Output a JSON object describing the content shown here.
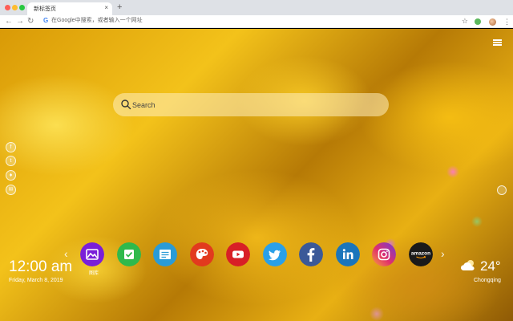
{
  "browser": {
    "tab_title": "新标签页",
    "tab_close": "×",
    "new_tab": "+",
    "omnibox_placeholder": "在Google中搜索，或者输入一个网址",
    "bookmark_icon": "star-icon",
    "menu_icon": "⋮"
  },
  "search": {
    "placeholder": "Search"
  },
  "apps": [
    {
      "name": "gallery",
      "label": "图库",
      "color": "#7a1fd8"
    },
    {
      "name": "checklist",
      "label": "",
      "color": "#2fb94c"
    },
    {
      "name": "notes",
      "label": "",
      "color": "#2a9bd6"
    },
    {
      "name": "paint",
      "label": "",
      "color": "#e23a1e"
    },
    {
      "name": "youtube",
      "label": "",
      "color": "#d81f26"
    },
    {
      "name": "twitter",
      "label": "",
      "color": "#2aa0e8"
    },
    {
      "name": "facebook",
      "label": "",
      "color": "#3b5998"
    },
    {
      "name": "linkedin",
      "label": "",
      "color": "#1a75bb"
    },
    {
      "name": "instagram",
      "label": "",
      "color": "#c13584"
    },
    {
      "name": "amazon",
      "label": "amazon",
      "color": "#1a1a1a"
    }
  ],
  "clock": {
    "time": "12:00 am",
    "date": "Friday, March 8, 2019"
  },
  "weather": {
    "temperature": "24°",
    "city": "Chongqing",
    "icon": "cloud-sun-icon"
  },
  "dock_nav": {
    "prev": "‹",
    "next": "›"
  }
}
